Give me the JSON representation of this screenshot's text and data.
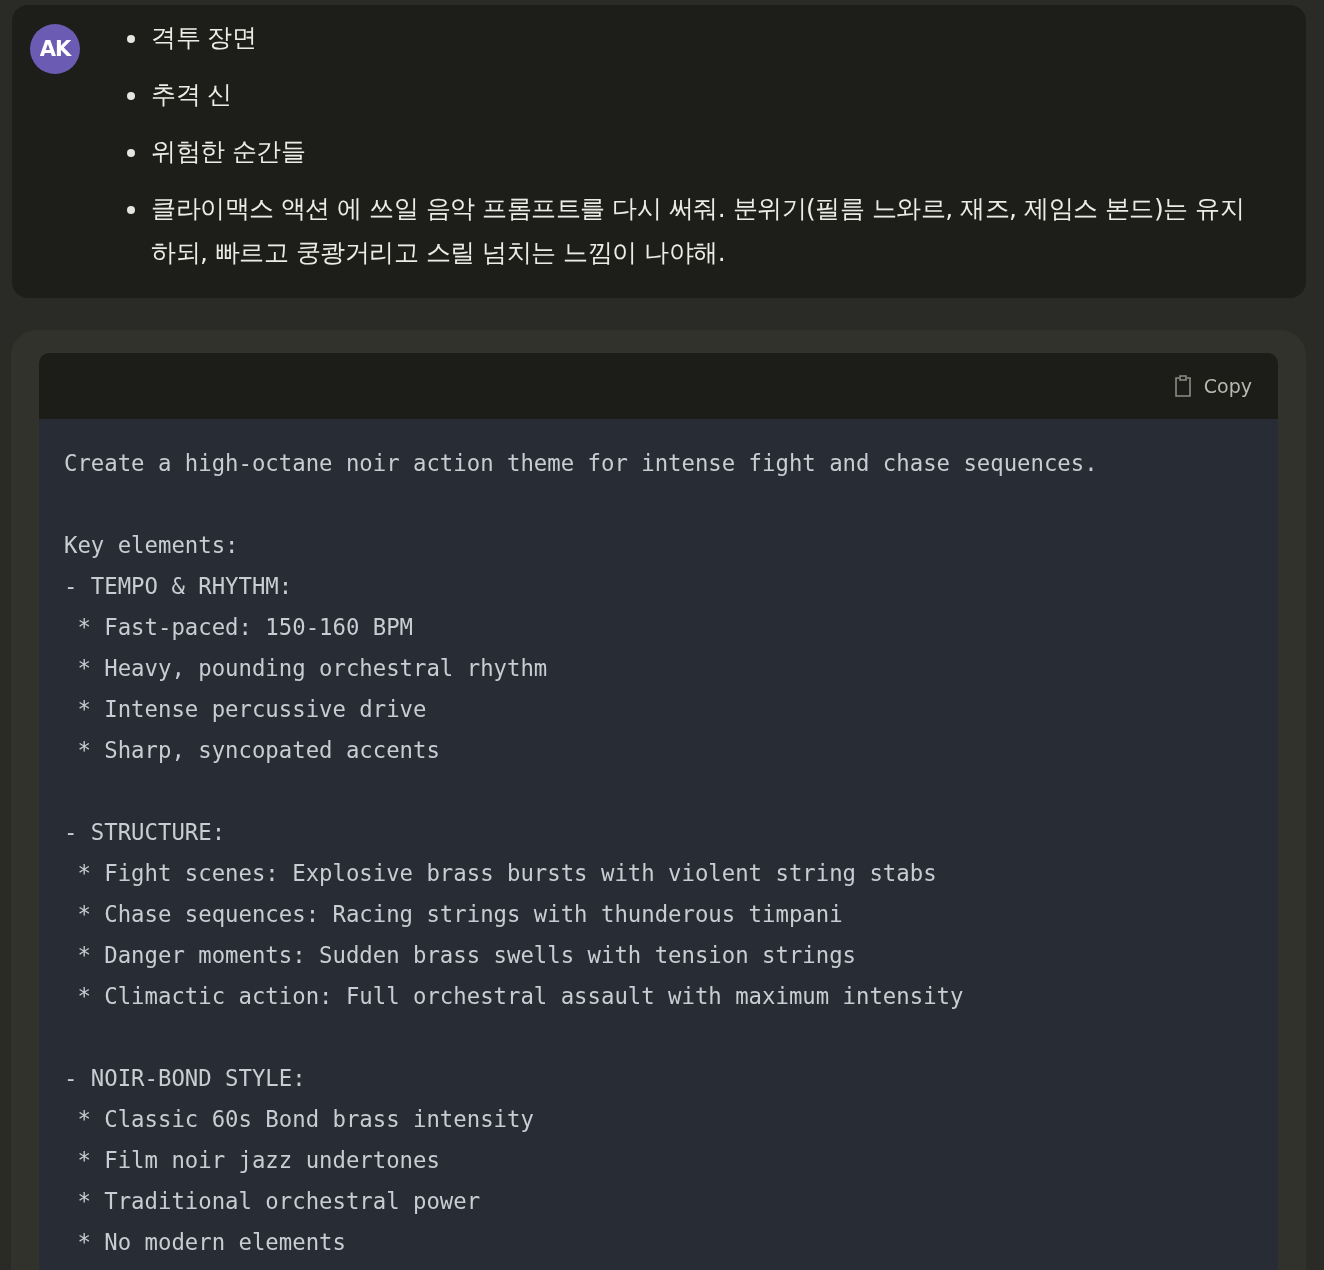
{
  "user_message": {
    "avatar": "AK",
    "bullets": [
      "격투 장면",
      "추격 신",
      "위험한 순간들",
      "클라이맥스 액션 에 쓰일 음악 프롬프트를 다시 써줘. 분위기(필름 느와르, 재즈, 제임스 본드)는 유지 하되, 빠르고 쿵쾅거리고 스릴 넘치는 느낌이 나야해."
    ]
  },
  "code_block": {
    "copy_label": "Copy",
    "paragraphs": [
      [
        "Create a high-octane noir action theme for intense fight and chase sequences."
      ],
      [
        "Key elements:",
        "- TEMPO & RHYTHM:",
        " * Fast-paced: 150-160 BPM",
        " * Heavy, pounding orchestral rhythm",
        " * Intense percussive drive",
        " * Sharp, syncopated accents"
      ],
      [
        "- STRUCTURE:",
        " * Fight scenes: Explosive brass bursts with violent string stabs",
        " * Chase sequences: Racing strings with thunderous timpani",
        " * Danger moments: Sudden brass swells with tension strings",
        " * Climactic action: Full orchestral assault with maximum intensity"
      ],
      [
        "- NOIR-BOND STYLE:",
        " * Classic 60s Bond brass intensity",
        " * Film noir jazz undertones",
        " * Traditional orchestral power",
        " * No modern elements"
      ]
    ]
  }
}
